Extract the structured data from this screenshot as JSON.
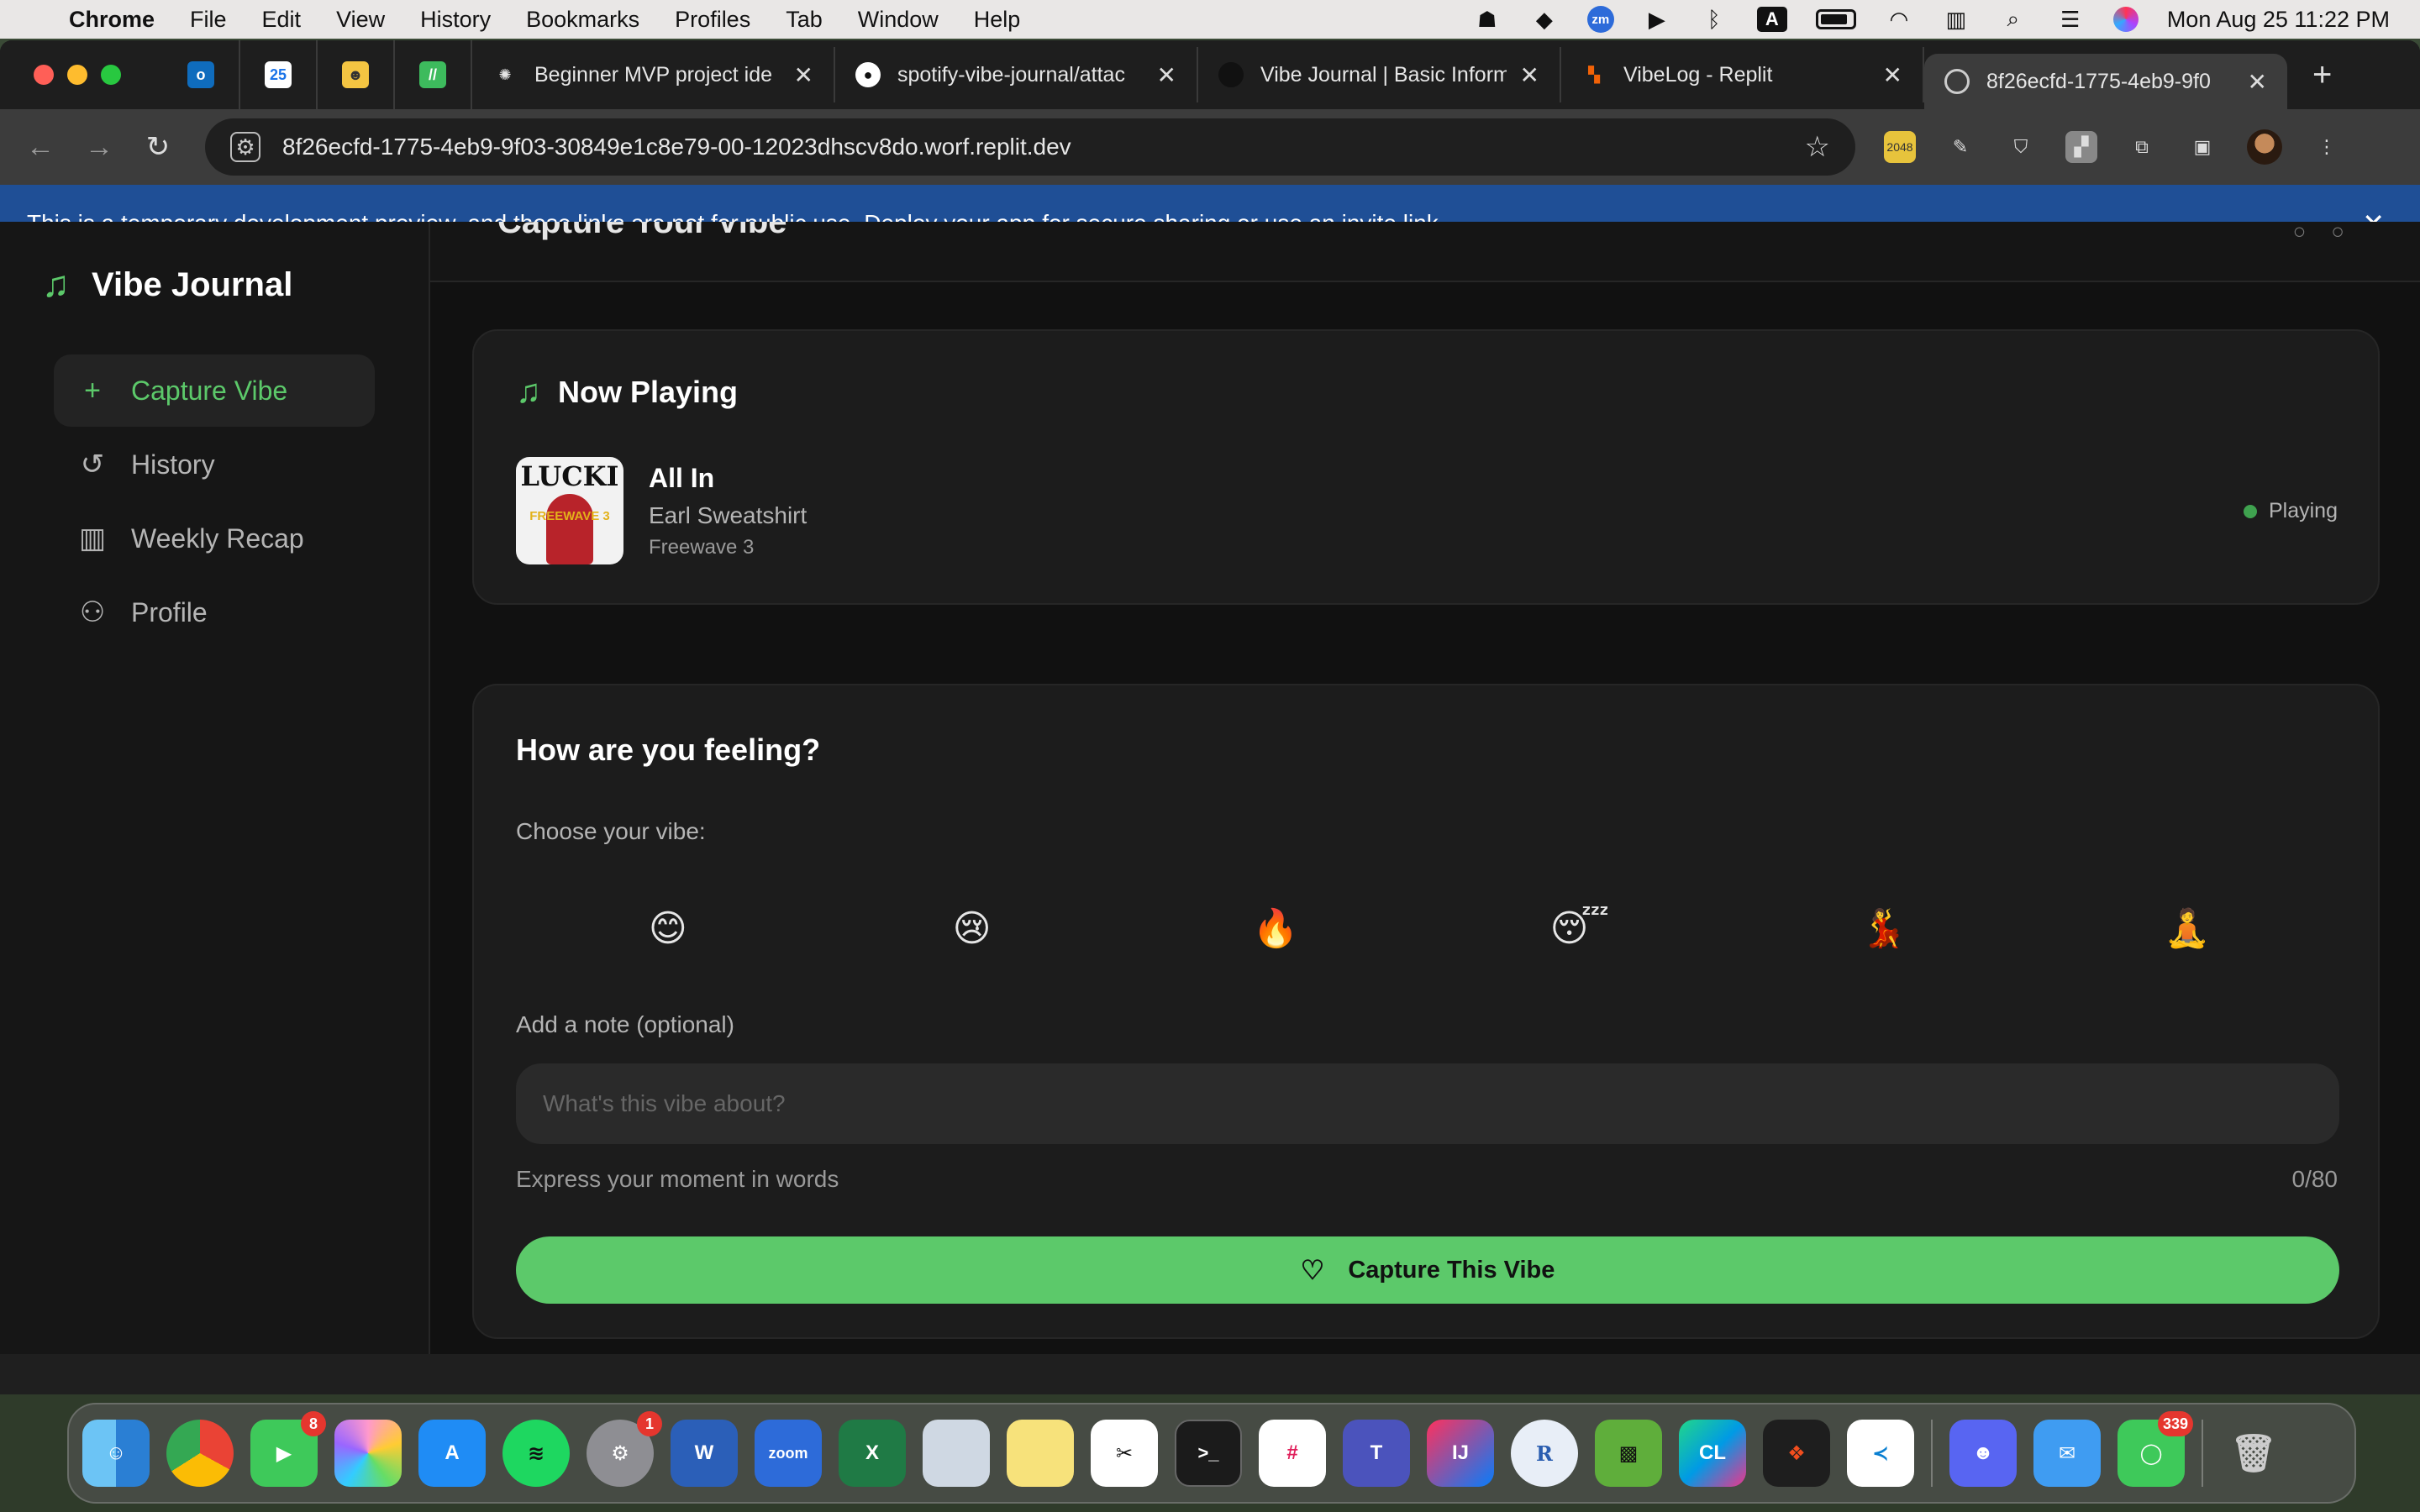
{
  "menubar": {
    "app": "Chrome",
    "items": [
      "File",
      "Edit",
      "View",
      "History",
      "Bookmarks",
      "Profiles",
      "Tab",
      "Window",
      "Help"
    ],
    "status_icons": [
      "teams-icon",
      "shield-icon",
      "zoom-icon",
      "play-icon",
      "bluetooth-icon",
      "input-source-icon",
      "battery-icon",
      "wifi-icon",
      "memory-icon",
      "search-icon",
      "control-center-icon",
      "siri-icon"
    ],
    "input_source": "A",
    "zoom_label": "zm",
    "clock": "Mon Aug 25  11:22 PM"
  },
  "tabs": [
    {
      "title": "Beginner MVP project ide",
      "icon": "openai-icon"
    },
    {
      "title": "spotify-vibe-journal/attac",
      "icon": "github-icon"
    },
    {
      "title": "Vibe Journal | Basic Inform",
      "icon": "notion-icon"
    },
    {
      "title": "VibeLog - Replit",
      "icon": "replit-icon"
    },
    {
      "title": "8f26ecfd-1775-4eb9-9f0",
      "icon": "globe-icon"
    }
  ],
  "pinned_tabs": [
    "outlook-icon",
    "calendar-icon",
    "user-icon",
    "app-icon"
  ],
  "calendar_day": "25",
  "address": {
    "url": "8f26ecfd-1775-4eb9-9f03-30849e1c8e79-00-12023dhscv8do.worf.replit.dev"
  },
  "banner": {
    "before": "This is a temporary development preview, and these links are not for public use.",
    "link": "Deploy your app",
    "after": "for secure sharing or use an invite link."
  },
  "app": {
    "brand": "Vibe Journal",
    "nav": [
      {
        "label": "Capture Vibe",
        "icon": "plus-icon"
      },
      {
        "label": "History",
        "icon": "history-icon"
      },
      {
        "label": "Weekly Recap",
        "icon": "bar-chart-icon"
      },
      {
        "label": "Profile",
        "icon": "user-icon"
      }
    ],
    "page_title": "Capture Your Vibe",
    "now_playing": {
      "title": "Now Playing",
      "song": "All In",
      "artist": "Earl Sweatshirt",
      "album": "Freewave 3",
      "status": "Playing",
      "cover_text_top": "LUCKI",
      "cover_text_mid": "FREEWAVE 3"
    },
    "feeling": {
      "heading": "How are you feeling?",
      "choose_label": "Choose your vibe:",
      "emojis": [
        "😊",
        "😢",
        "🔥",
        "😴",
        "💃",
        "🧘"
      ],
      "note_label": "Add a note (optional)",
      "note_placeholder": "What's this vibe about?",
      "note_value": "",
      "hint": "Express your moment in words",
      "counter": "0/80",
      "button": "Capture This Vibe"
    }
  },
  "dock": {
    "apps": [
      "Finder",
      "Chrome",
      "FaceTime",
      "Photos",
      "App Store",
      "Spotify",
      "System Settings",
      "Word",
      "Zoom",
      "Excel",
      "Preview",
      "Notes",
      "CapCut",
      "Terminal",
      "Slack",
      "Teams",
      "IntelliJ IDEA",
      "R",
      "Minecraft",
      "CLion",
      "Figma",
      "VS Code",
      "Discord",
      "Mail",
      "Messages",
      "Trash"
    ],
    "badges": {
      "facetime": "8",
      "settings": "1",
      "messages": "339"
    },
    "labels": {
      "zoom": "zoom",
      "word": "W",
      "excel": "X",
      "intellij": "IJ",
      "clion": "CL",
      "r": "R",
      "terminal": ">_"
    }
  },
  "colors": {
    "accent": "#5cc96a",
    "banner": "#1f4f96",
    "sidebar_bg": "#161616",
    "card_bg": "#1c1c1c",
    "status_dot": "#3fa24f"
  }
}
